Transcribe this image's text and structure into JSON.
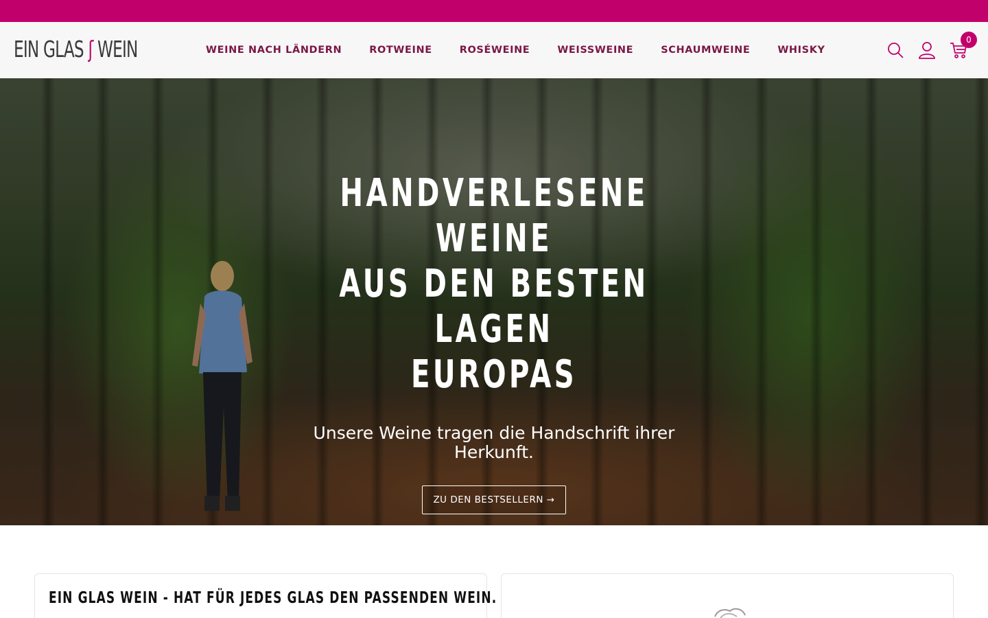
{
  "brand": {
    "logo_part1": "EIN GLAS",
    "logo_part2": "WEIN",
    "accent_color": "#c2006b",
    "nav_color": "#7a1745"
  },
  "nav": {
    "items": [
      {
        "label": "WEINE NACH LÄNDERN"
      },
      {
        "label": "ROTWEINE"
      },
      {
        "label": "ROSÉWEINE"
      },
      {
        "label": "WEISSWEINE"
      },
      {
        "label": "SCHAUMWEINE"
      },
      {
        "label": "WHISKY"
      }
    ]
  },
  "header_icons": {
    "search": "search-icon",
    "account": "user-icon",
    "cart": "cart-icon",
    "cart_count": "0"
  },
  "hero": {
    "title_line1": "HANDVERLESENE WEINE",
    "title_line2": "AUS DEN BESTEN LAGEN",
    "title_line3": "EUROPAS",
    "subtitle": "Unsere Weine tragen die Handschrift ihrer Herkunft.",
    "button_label": "ZU DEN BESTSELLERN →"
  },
  "cards": [
    {
      "title": "EIN GLAS WEIN - HAT FÜR JEDES GLAS DEN PASSENDEN WEIN."
    },
    {
      "title": ""
    }
  ]
}
